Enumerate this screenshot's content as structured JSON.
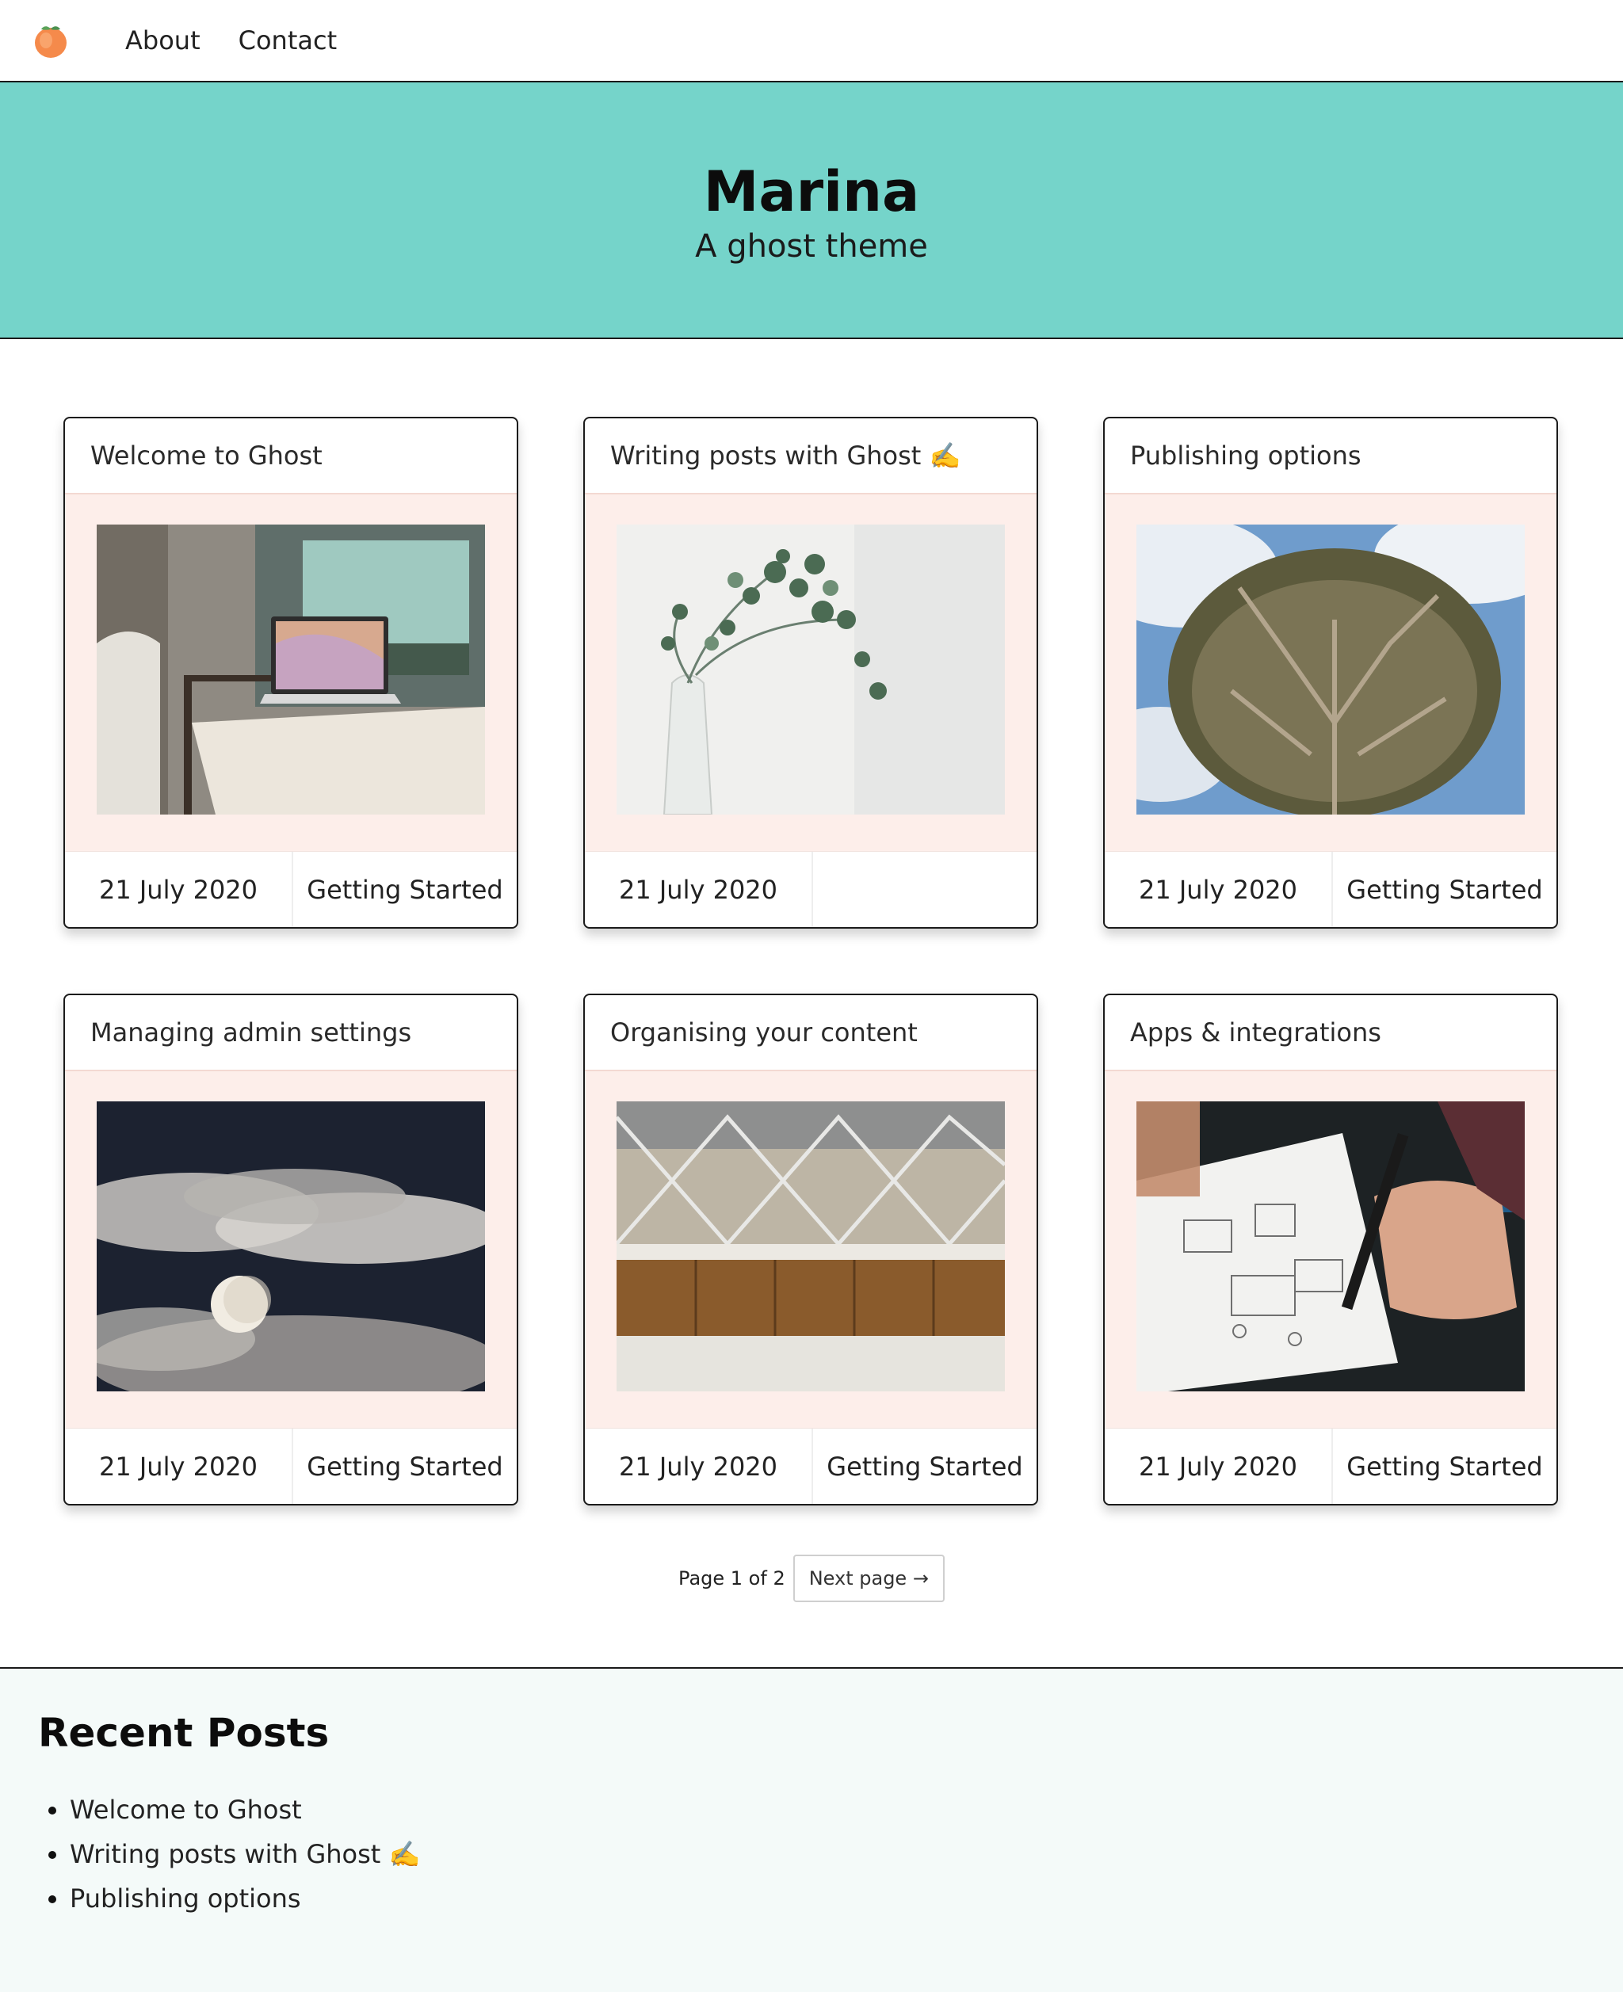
{
  "nav": {
    "logo_icon": "peach-icon",
    "links": [
      "About",
      "Contact"
    ]
  },
  "hero": {
    "title": "Marina",
    "subtitle": "A ghost theme",
    "background": "#75d4ca"
  },
  "posts": [
    {
      "title": "Welcome to Ghost",
      "date": "21 July 2020",
      "tag": "Getting Started",
      "image": "laptop-on-bench-image"
    },
    {
      "title": "Writing posts with Ghost ✍️",
      "date": "21 July 2020",
      "tag": "",
      "image": "eucalyptus-vase-image"
    },
    {
      "title": "Publishing options",
      "date": "21 July 2020",
      "tag": "Getting Started",
      "image": "dragon-tree-image"
    },
    {
      "title": "Managing admin settings",
      "date": "21 July 2020",
      "tag": "Getting Started",
      "image": "moon-clouds-image"
    },
    {
      "title": "Organising your content",
      "date": "21 July 2020",
      "tag": "Getting Started",
      "image": "building-facade-image"
    },
    {
      "title": "Apps & integrations",
      "date": "21 July 2020",
      "tag": "Getting Started",
      "image": "hand-sketching-image"
    }
  ],
  "pagination": {
    "info": "Page 1 of 2",
    "next_label": "Next page →"
  },
  "footer": {
    "heading": "Recent Posts",
    "recent": [
      "Welcome to Ghost",
      "Writing posts with Ghost ✍️",
      "Publishing options"
    ]
  },
  "colors": {
    "accent": "#75d4ca",
    "card_media_bg": "#fdeeea",
    "footer_bg": "#f4faf9"
  }
}
